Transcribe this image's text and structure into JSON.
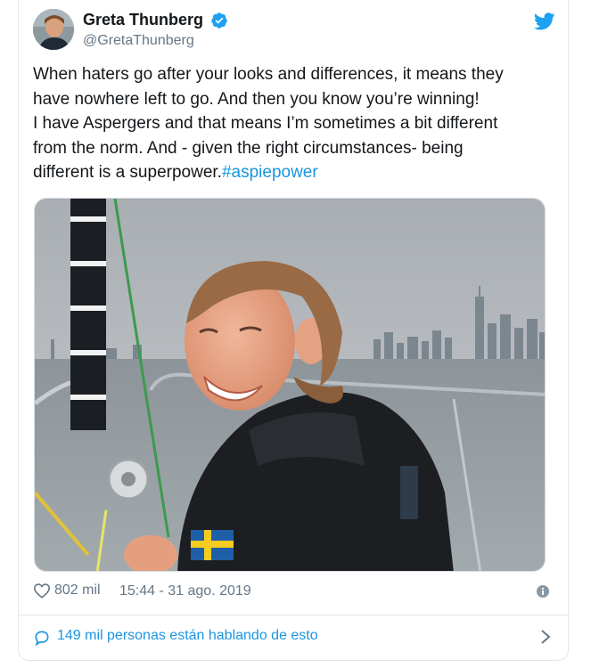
{
  "author": {
    "display_name": "Greta Thunberg",
    "handle": "@GretaThunberg",
    "verified": true
  },
  "tweet": {
    "lines": [
      "When haters go after your looks and differences, it means they",
      "have nowhere left to go. And then you know you’re winning!",
      "I have Aspergers and that means I’m sometimes a bit different",
      "from the norm. And - given the right circumstances- being",
      "different is a superpower."
    ],
    "hashtag": "#aspiepower"
  },
  "meta": {
    "like_count": "802 mil",
    "timestamp": "15:44 - 31 ago. 2019"
  },
  "conversation": {
    "label": "149 mil personas están hablando de esto"
  },
  "icons": {
    "verified": "verified-badge-icon",
    "brand": "twitter-bird-icon",
    "like": "heart-icon",
    "info": "info-icon",
    "conversation": "speech-bubble-icon",
    "more": "chevron-right-icon"
  },
  "colors": {
    "link": "#1b95e0",
    "text": "#14171a",
    "secondary": "#657786",
    "border": "#e1e8ed"
  }
}
